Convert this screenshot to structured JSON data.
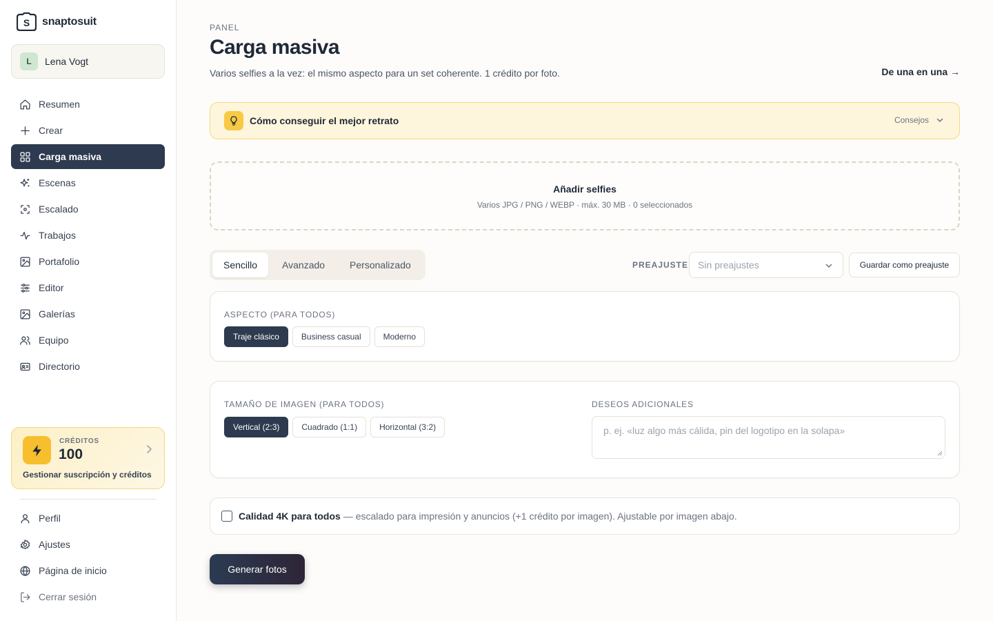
{
  "brand": {
    "name": "snaptosuit"
  },
  "user": {
    "initial": "L",
    "name": "Lena Vogt"
  },
  "nav": {
    "items": [
      {
        "label": "Resumen",
        "icon": "home-icon"
      },
      {
        "label": "Crear",
        "icon": "plus-icon"
      },
      {
        "label": "Carga masiva",
        "icon": "grid-icon",
        "active": true
      },
      {
        "label": "Escenas",
        "icon": "sparkles-icon"
      },
      {
        "label": "Escalado",
        "icon": "scan-icon"
      },
      {
        "label": "Trabajos",
        "icon": "activity-icon"
      },
      {
        "label": "Portafolio",
        "icon": "image-icon"
      },
      {
        "label": "Editor",
        "icon": "sliders-icon"
      },
      {
        "label": "Galerías",
        "icon": "gallery-icon"
      },
      {
        "label": "Equipo",
        "icon": "users-icon"
      },
      {
        "label": "Directorio",
        "icon": "id-card-icon"
      }
    ],
    "bottom": [
      {
        "label": "Perfil",
        "icon": "user-icon"
      },
      {
        "label": "Ajustes",
        "icon": "gear-icon"
      },
      {
        "label": "Página de inicio",
        "icon": "globe-icon"
      },
      {
        "label": "Cerrar sesión",
        "icon": "logout-icon"
      }
    ]
  },
  "credits": {
    "label": "CRÉDITOS",
    "value": "100",
    "manage": "Gestionar suscripción y créditos"
  },
  "header": {
    "eyebrow": "PANEL",
    "title": "Carga masiva",
    "subtitle": "Varios selfies a la vez: el mismo aspecto para un set coherente. 1 crédito por foto.",
    "one_by_one": "De una en una →"
  },
  "tips": {
    "title": "Cómo conseguir el mejor retrato",
    "toggle": "Consejos"
  },
  "dropzone": {
    "title": "Añadir selfies",
    "subtitle": "Varios JPG / PNG / WEBP · máx. 30 MB · 0 seleccionados"
  },
  "modes": [
    "Sencillo",
    "Avanzado",
    "Personalizado"
  ],
  "preset": {
    "label": "PREAJUSTE",
    "placeholder": "Sin preajustes",
    "save": "Guardar como preajuste"
  },
  "aspect": {
    "label": "ASPECTO (PARA TODOS)",
    "options": [
      "Traje clásico",
      "Business casual",
      "Moderno"
    ],
    "selected": "Traje clásico"
  },
  "size": {
    "label": "TAMAÑO DE IMAGEN (PARA TODOS)",
    "options": [
      "Vertical (2:3)",
      "Cuadrado (1:1)",
      "Horizontal (3:2)"
    ],
    "selected": "Vertical (2:3)"
  },
  "wishes": {
    "label": "DESEOS ADICIONALES",
    "placeholder": "p. ej. «luz algo más cálida, pin del logotipo en la solapa»"
  },
  "quality": {
    "title": "Calidad 4K para todos",
    "description": "— escalado para impresión y anuncios (+1 crédito por imagen). Ajustable por imagen abajo.",
    "checked": false
  },
  "generate_label": "Generar fotos",
  "colors": {
    "accent": "#2d3a4f",
    "credits_bg": "#fdf0c7",
    "bolt": "#f7be2d",
    "tips_bg": "#fef6dc"
  }
}
